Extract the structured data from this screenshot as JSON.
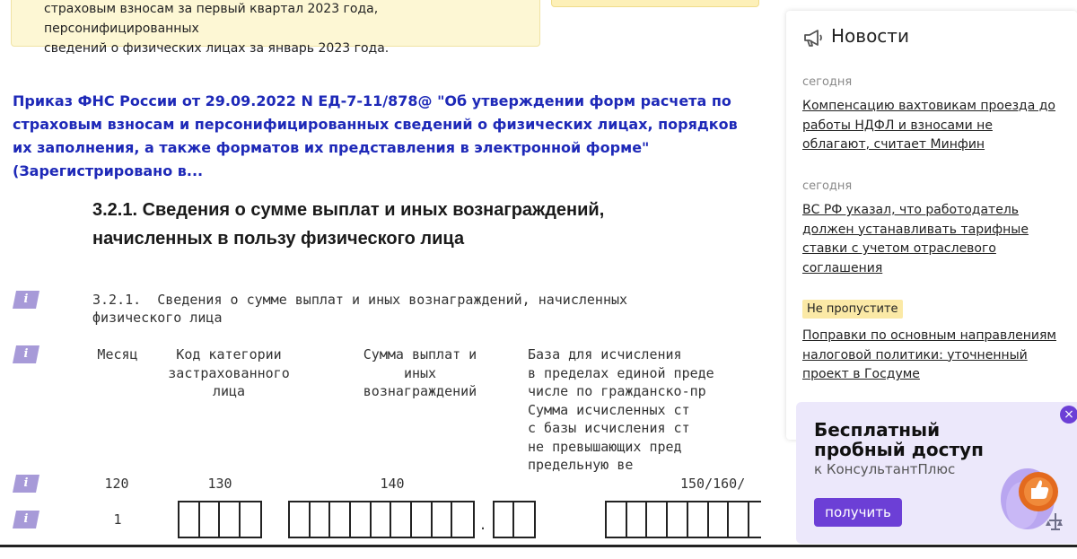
{
  "note": {
    "line1": "страховым взносам за первый квартал 2023 года, персонифицированных",
    "line2": "сведений о физических лицах за январь 2023 года."
  },
  "doc_link": {
    "text": "Приказ ФНС России от 29.09.2022 N ЕД-7-11/878@ \"Об утверждении форм расчета по страховым взносам и персонифицированных сведений о физических лицах, порядков их заполнения, а также форматов их представления в электронной форме\" (Зарегистрировано в..."
  },
  "section": {
    "heading_line1": "3.2.1. Сведения о сумме выплат и иных вознаграждений,",
    "heading_line2": "начисленных в пользу физического лица"
  },
  "form": {
    "info_icon_glyph": "i",
    "mono_line1": "3.2.1.  Сведения о сумме выплат и иных вознаграждений, начисленных",
    "mono_line2": "физического лица",
    "col_month": "Месяц",
    "col_category": "Код категории\nзастрахованного\nлица",
    "col_payments": "Сумма выплат и\nиных\nвознаграждений",
    "col_base": "База для исчисления\nв пределах единой преде\nчисле по гражданско-пр\nСумма исчисленных ст\nс базы исчисления ст\nне превышающих пред\nпредельную ве",
    "code_month": "120",
    "code_category": "130",
    "code_payments": "140",
    "code_base": "150/160/",
    "row_number": "1",
    "decimal_point": "."
  },
  "news": {
    "title": "Новости",
    "items": [
      {
        "date": "сегодня",
        "text": "Компенсацию вахтовикам проезда до работы НДФЛ и взносами не облагают, считает Минфин"
      },
      {
        "date": "сегодня",
        "text": "ВС РФ указал, что работодатель должен устанавливать тарифные ставки с учетом отраслевого соглашения"
      },
      {
        "badge": "Не пропустите",
        "text": "Поправки по основным направлениям налоговой политики: уточненный проект в Госдуме"
      }
    ]
  },
  "promo": {
    "title_line1": "Бесплатный",
    "title_line2": "пробный доступ",
    "subtitle": "к КонсультантПлюс",
    "button_label": "получить",
    "close_glyph": "×"
  },
  "colors": {
    "link": "#1e29b8",
    "note_bg": "#fdf7d4",
    "accent": "#6c3fd6",
    "info_icon": "#a79ad8",
    "badge_bg": "#fbe9a6"
  }
}
